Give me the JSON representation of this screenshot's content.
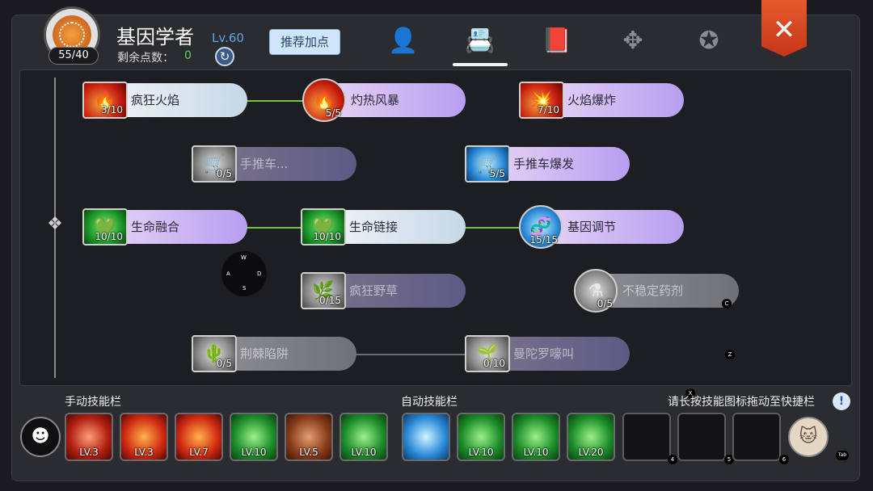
{
  "header": {
    "title": "基因学者",
    "level": "Lv.60",
    "points": "55/40",
    "remain_label": "剩余点数：",
    "remain_value": "0",
    "recommend_label": "推荐加点",
    "tabs": [
      {
        "icon": "person-star-icon",
        "glyph": "👤"
      },
      {
        "icon": "contact-book-icon",
        "glyph": "📇"
      },
      {
        "icon": "book-icon",
        "glyph": "📕"
      },
      {
        "icon": "cross-arrows-icon",
        "glyph": "✥"
      },
      {
        "icon": "winged-badge-icon",
        "glyph": "✪"
      }
    ],
    "close_glyph": "✕"
  },
  "tree": {
    "nodes": [
      {
        "name": "疯狂火焰",
        "count": "3/10",
        "style": "white",
        "icon": "red"
      },
      {
        "name": "灼热风暴",
        "count": "5/5",
        "style": "purple",
        "icon": "red"
      },
      {
        "name": "火焰爆炸",
        "count": "7/10",
        "style": "purple",
        "icon": "red"
      },
      {
        "name": "手推车...",
        "count": "0/5",
        "style": "dimpurple",
        "icon": "gray"
      },
      {
        "name": "手推车爆发",
        "count": "5/5",
        "style": "purple",
        "icon": "blue"
      },
      {
        "name": "生命融合",
        "count": "10/10",
        "style": "purple",
        "icon": "green"
      },
      {
        "name": "生命链接",
        "count": "10/10",
        "style": "white",
        "icon": "green"
      },
      {
        "name": "基因调节",
        "count": "15/15",
        "style": "purple",
        "icon": "blue"
      },
      {
        "name": "疯狂野草",
        "count": "0/15",
        "style": "dimpurple",
        "icon": "gray"
      },
      {
        "name": "不稳定药剂",
        "count": "0/5",
        "style": "dimgray",
        "icon": "gray"
      },
      {
        "name": "荆棘陷阱",
        "count": "0/5",
        "style": "dimgray",
        "icon": "gray"
      },
      {
        "name": "曼陀罗嚎叫",
        "count": "0/10",
        "style": "dimpurple",
        "icon": "gray"
      }
    ],
    "wasd": {
      "w": "W",
      "a": "A",
      "s": "S",
      "d": "D"
    },
    "key_c": "C",
    "key_z": "Z",
    "key_x": "X"
  },
  "bottom": {
    "manual_label": "手动技能栏",
    "auto_label": "自动技能栏",
    "hint_label": "请长按技能图标拖动至快捷栏",
    "info_glyph": "!",
    "manual_slots": [
      "LV.3",
      "LV.3",
      "LV.7",
      "LV.10",
      "LV.5",
      "LV.10"
    ],
    "auto_slots": [
      "",
      "LV.10",
      "LV.10",
      "LV.20"
    ],
    "empty_slot_numbers": [
      "4",
      "5",
      "6"
    ],
    "tab_hint": "Tab"
  }
}
